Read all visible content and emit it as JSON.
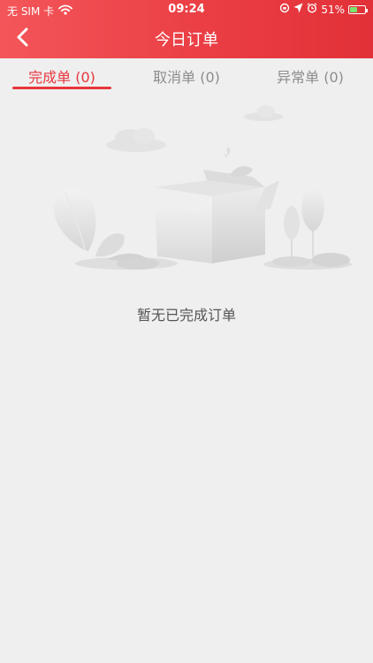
{
  "status_bar": {
    "carrier": "无 SIM 卡",
    "time": "09:24",
    "battery": "51%",
    "battery_level": 0.51,
    "icons": [
      "wifi-icon",
      "rotation-lock-icon",
      "location-icon",
      "alarm-icon",
      "battery-charging-icon"
    ]
  },
  "nav": {
    "title": "今日订单",
    "back_icon": "chevron-left-icon"
  },
  "tabs": [
    {
      "label": "完成单 (0)",
      "active": true
    },
    {
      "label": "取消单 (0)",
      "active": false
    },
    {
      "label": "异常单 (0)",
      "active": false
    }
  ],
  "empty_state": {
    "message": "暂无已完成订单",
    "illustration_icon": "empty-box-icon"
  },
  "colors": {
    "accent": "#e7363c",
    "header_gradient_start": "#f3565a",
    "header_gradient_end": "#e23138",
    "background": "#efefef",
    "tab_inactive": "#8d8d8d"
  }
}
